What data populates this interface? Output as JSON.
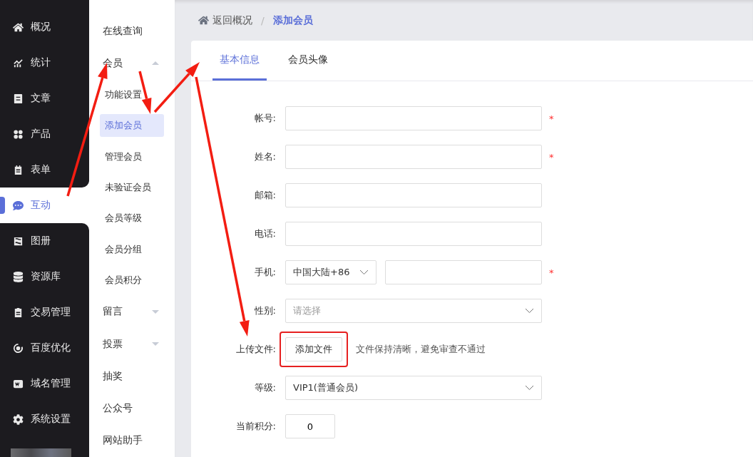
{
  "sidebar": {
    "items": [
      {
        "label": "概况",
        "selected": false
      },
      {
        "label": "统计",
        "selected": false
      },
      {
        "label": "文章",
        "selected": false
      },
      {
        "label": "产品",
        "selected": false
      },
      {
        "label": "表单",
        "selected": false
      },
      {
        "label": "互动",
        "selected": true
      },
      {
        "label": "图册",
        "selected": false
      },
      {
        "label": "资源库",
        "selected": false
      },
      {
        "label": "交易管理",
        "selected": false
      },
      {
        "label": "百度优化",
        "selected": false
      },
      {
        "label": "域名管理",
        "selected": false
      },
      {
        "label": "系统设置",
        "selected": false
      }
    ]
  },
  "submenu": {
    "items": [
      {
        "label": "在线查询",
        "selected": false
      },
      {
        "label": "会员",
        "selected": false,
        "expanded": true,
        "children": [
          {
            "label": "功能设置",
            "selected": false
          },
          {
            "label": "添加会员",
            "selected": true
          },
          {
            "label": "管理会员",
            "selected": false
          },
          {
            "label": "未验证会员",
            "selected": false
          },
          {
            "label": "会员等级",
            "selected": false
          },
          {
            "label": "会员分组",
            "selected": false
          },
          {
            "label": "会员积分",
            "selected": false
          }
        ]
      },
      {
        "label": "留言",
        "selected": false,
        "expanded": false
      },
      {
        "label": "投票",
        "selected": false,
        "expanded": false
      },
      {
        "label": "抽奖",
        "selected": false
      },
      {
        "label": "公众号",
        "selected": false
      },
      {
        "label": "网站助手",
        "selected": false
      }
    ]
  },
  "breadcrumb": {
    "back": "返回概况",
    "separator": "/",
    "current": "添加会员"
  },
  "tabs": [
    {
      "label": "基本信息",
      "selected": true
    },
    {
      "label": "会员头像",
      "selected": false
    }
  ],
  "form": {
    "fields": [
      {
        "kind": "text",
        "label": "帐号:",
        "required_mark": "*"
      },
      {
        "kind": "text",
        "label": "姓名:",
        "required_mark": "*"
      },
      {
        "kind": "text",
        "label": "邮箱:"
      },
      {
        "kind": "text",
        "label": "电话:"
      },
      {
        "kind": "phone",
        "label": "手机:",
        "required_mark": "*",
        "country": "中国大陆+86"
      },
      {
        "kind": "select",
        "label": "性别:",
        "placeholder": "请选择"
      },
      {
        "kind": "file",
        "label": "上传文件:",
        "button": "添加文件",
        "hint": "文件保持清晰，避免审查不通过"
      },
      {
        "kind": "select",
        "label": "等级:",
        "value": "VIP1(普通会员)"
      },
      {
        "kind": "number",
        "label": "当前积分:",
        "value": "0"
      }
    ]
  }
}
